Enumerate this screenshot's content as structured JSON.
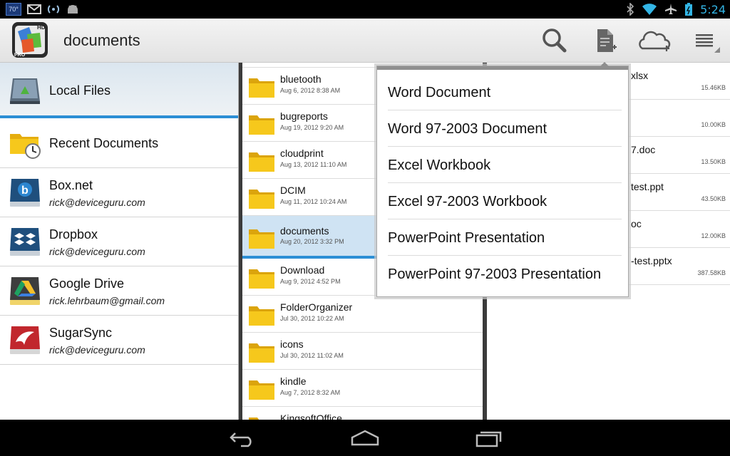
{
  "status_bar": {
    "temperature": "70°",
    "time": "5:24",
    "left_icons": [
      "weather-icon",
      "gmail-icon",
      "hotspot-icon",
      "android-icon"
    ],
    "right_icons": [
      "bluetooth-icon",
      "wifi-icon",
      "airplane-icon",
      "battery-icon"
    ]
  },
  "action_bar": {
    "title": "documents",
    "logo_badge_top": "HD",
    "logo_badge_bottom": "PRO",
    "actions": [
      "search-icon",
      "new-document-icon",
      "cloud-add-icon",
      "overflow-menu-icon"
    ]
  },
  "sidebar": {
    "items": [
      {
        "label": "Local Files",
        "account": "",
        "icon": "sd-card-icon"
      },
      {
        "label": "Recent Documents",
        "account": "",
        "icon": "recent-folder-icon"
      },
      {
        "label": "Box.net",
        "account": "rick@deviceguru.com",
        "icon": "box-drive-icon"
      },
      {
        "label": "Dropbox",
        "account": "rick@deviceguru.com",
        "icon": "dropbox-drive-icon"
      },
      {
        "label": "Google Drive",
        "account": "rick.lehrbaum@gmail.com",
        "icon": "google-drive-icon"
      },
      {
        "label": "SugarSync",
        "account": "rick@deviceguru.com",
        "icon": "sugarsync-drive-icon"
      }
    ]
  },
  "folders": [
    {
      "name": "bluetooth",
      "date": "Aug 6, 2012 8:38 AM"
    },
    {
      "name": "bugreports",
      "date": "Aug 19, 2012 9:20 AM"
    },
    {
      "name": "cloudprint",
      "date": "Aug 13, 2012 11:10 AM"
    },
    {
      "name": "DCIM",
      "date": "Aug 11, 2012 10:24 AM"
    },
    {
      "name": "documents",
      "date": "Aug 20, 2012 3:32 PM"
    },
    {
      "name": "Download",
      "date": "Aug 9, 2012 4:52 PM"
    },
    {
      "name": "FolderOrganizer",
      "date": "Jul 30, 2012 10:22 AM"
    },
    {
      "name": "icons",
      "date": "Jul 30, 2012 11:02 AM"
    },
    {
      "name": "kindle",
      "date": "Aug 7, 2012 8:32 AM"
    },
    {
      "name": "KingsoftOffice",
      "date": ""
    }
  ],
  "files": [
    {
      "name": "xlsx",
      "size": "15.46KB"
    },
    {
      "name": "",
      "size": "10.00KB"
    },
    {
      "name": "7.doc",
      "size": "13.50KB"
    },
    {
      "name": "test.ppt",
      "size": "43.50KB"
    },
    {
      "name": "oc",
      "size": "12.00KB"
    },
    {
      "name": "-test.pptx",
      "size": "387.58KB"
    }
  ],
  "new_document_menu": {
    "items": [
      "Word Document",
      "Word 97-2003 Document",
      "Excel Workbook",
      "Excel 97-2003 Workbook",
      "PowerPoint Presentation",
      "PowerPoint 97-2003 Presentation"
    ]
  },
  "nav_bar": {
    "buttons": [
      "back-icon",
      "home-icon",
      "recent-apps-icon"
    ]
  },
  "colors": {
    "accent": "#2c8fd5",
    "clock": "#33b5e5",
    "folder_yellow": "#f6c81c"
  }
}
